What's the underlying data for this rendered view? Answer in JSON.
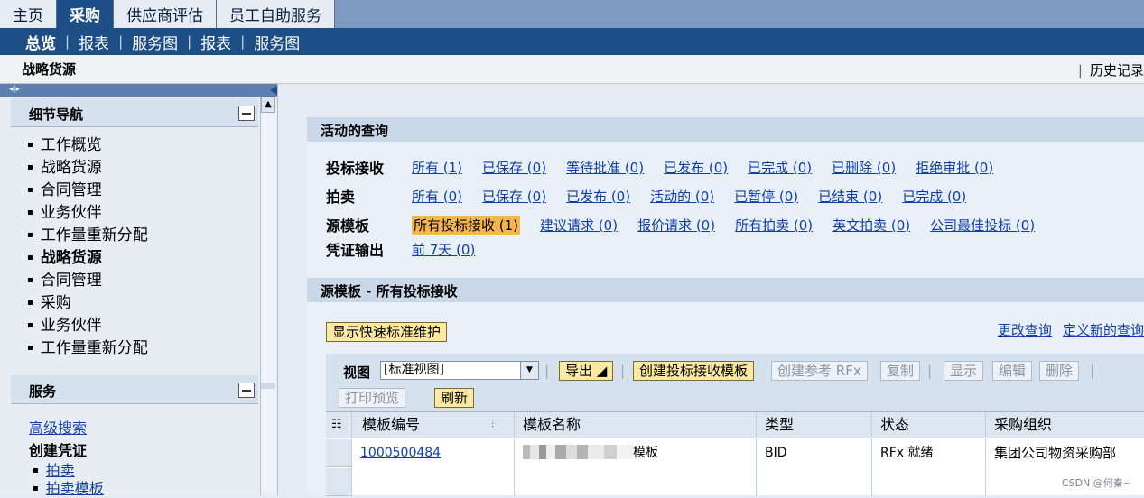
{
  "top_tabs": [
    {
      "label": "主页"
    },
    {
      "label": "采购"
    },
    {
      "label": "供应商评估"
    },
    {
      "label": "员工自助服务"
    }
  ],
  "subnav": [
    "总览",
    "报表",
    "服务图",
    "报表",
    "服务图"
  ],
  "title": "战略货源",
  "history_label": "历史记录",
  "left_nav": {
    "panel_title": "细节导航",
    "items": [
      "工作概览",
      "战略货源",
      "合同管理",
      "业务伙伴",
      "工作量重新分配",
      "战略货源",
      "合同管理",
      "采购",
      "业务伙伴",
      "工作量重新分配"
    ],
    "services_title": "服务",
    "advanced_search": "高级搜索",
    "create_doc": "创建凭证",
    "sub_auction": "拍卖",
    "sub_auction_template": "拍卖模板"
  },
  "queries": {
    "section_title": "活动的查询",
    "rows": [
      {
        "label": "投标接收",
        "links": [
          "所有 (1)",
          "已保存 (0)",
          "等待批准 (0)",
          "已发布 (0)",
          "已完成 (0)",
          "已删除 (0)",
          "拒绝审批 (0)"
        ]
      },
      {
        "label": "拍卖",
        "links": [
          "所有 (0)",
          "已保存 (0)",
          "已发布 (0)",
          "活动的 (0)",
          "已暂停 (0)",
          "已结束 (0)",
          "已完成 (0)"
        ]
      },
      {
        "label": "源模板",
        "links": [
          "所有投标接收 (1)",
          "建议请求 (0)",
          "报价请求 (0)",
          "所有拍卖 (0)",
          "英文拍卖 (0)",
          "公司最佳投标 (0)"
        ]
      },
      {
        "label": "凭证输出",
        "links": [
          "前 7天 (0)"
        ]
      }
    ]
  },
  "results": {
    "section_title": "源模板 - 所有投标接收",
    "quick_criteria_button": "显示快速标准维护",
    "change_query": "更改查询",
    "define_new_query": "定义新的查询",
    "view_label": "视图",
    "view_value": "[标准视图]",
    "buttons": {
      "export": "导出",
      "create_template": "创建投标接收模板",
      "create_ref": "创建参考 RFx",
      "copy": "复制",
      "display": "显示",
      "edit": "编辑",
      "delete": "删除",
      "print_preview": "打印预览",
      "refresh": "刷新"
    },
    "columns": [
      "模板编号",
      "模板名称",
      "类型",
      "状态",
      "采购组织"
    ],
    "rows": [
      {
        "number": "1000500484",
        "name_suffix": "模板",
        "type": "BID",
        "status": "RFx 就绪",
        "org": "集团公司物资采购部"
      }
    ]
  },
  "watermark": "CSDN @何秦~"
}
